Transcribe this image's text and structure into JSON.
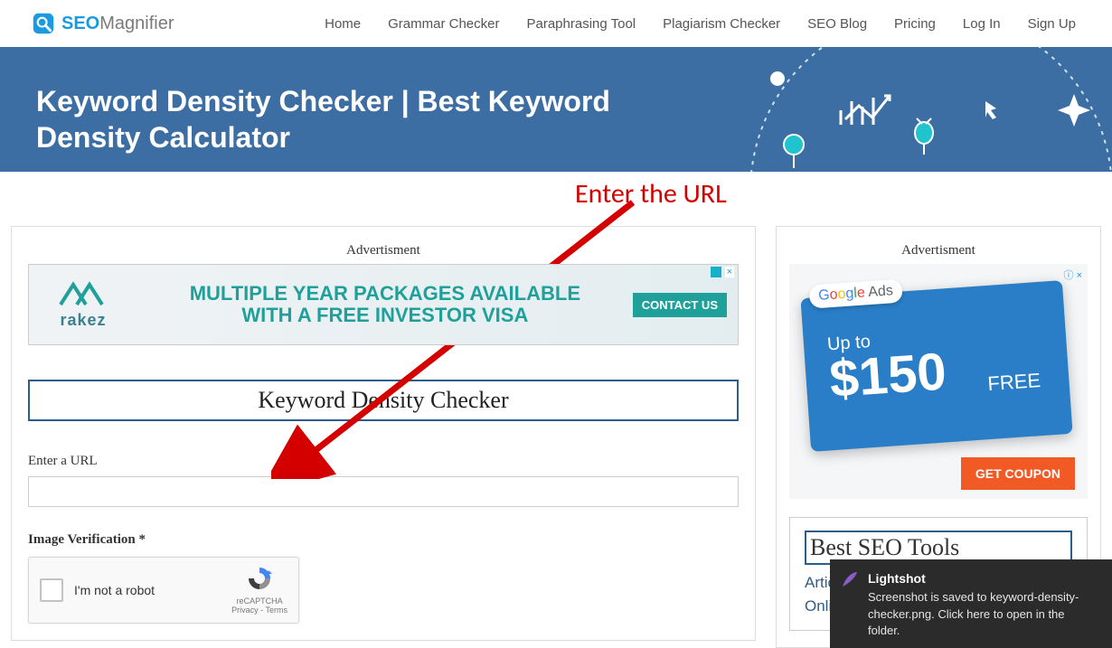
{
  "logo": {
    "seo": "SEO",
    "magnifier": "Magnifier"
  },
  "nav": {
    "home": "Home",
    "grammar": "Grammar Checker",
    "paraphrase": "Paraphrasing Tool",
    "plagiarism": "Plagiarism Checker",
    "blog": "SEO Blog",
    "pricing": "Pricing",
    "login": "Log In",
    "signup": "Sign Up"
  },
  "hero": {
    "title": "Keyword Density Checker | Best Keyword Density Calculator"
  },
  "main": {
    "ad_label": "Advertisment",
    "ad_headline_l1": "MULTIPLE YEAR PACKAGES AVAILABLE",
    "ad_headline_l2": "WITH A FREE INVESTOR VISA",
    "ad_brand": "rakez",
    "ad_cta": "CONTACT US",
    "ad_corner": "×",
    "tool_title": "Keyword Density Checker",
    "url_label": "Enter a URL",
    "verify_label": "Image Verification *",
    "recaptcha_text": "I'm not a robot",
    "recaptcha_brand": "reCAPTCHA",
    "recaptcha_terms": "Privacy - Terms"
  },
  "side": {
    "ad_label": "Advertisment",
    "gads_chip_google": "Google",
    "gads_chip_ads": " Ads",
    "gads_up": "Up to",
    "gads_amount": "$150",
    "gads_free": "FREE",
    "coupon": "GET COUPON",
    "box_title": "Best SEO Tools",
    "link1": "Article S",
    "link2": "Online A",
    "ad_corner": "×"
  },
  "annotation": {
    "text": "Enter the URL"
  },
  "toast": {
    "title": "Lightshot",
    "body": "Screenshot is saved to keyword-density-checker.png. Click here to open in the folder."
  }
}
